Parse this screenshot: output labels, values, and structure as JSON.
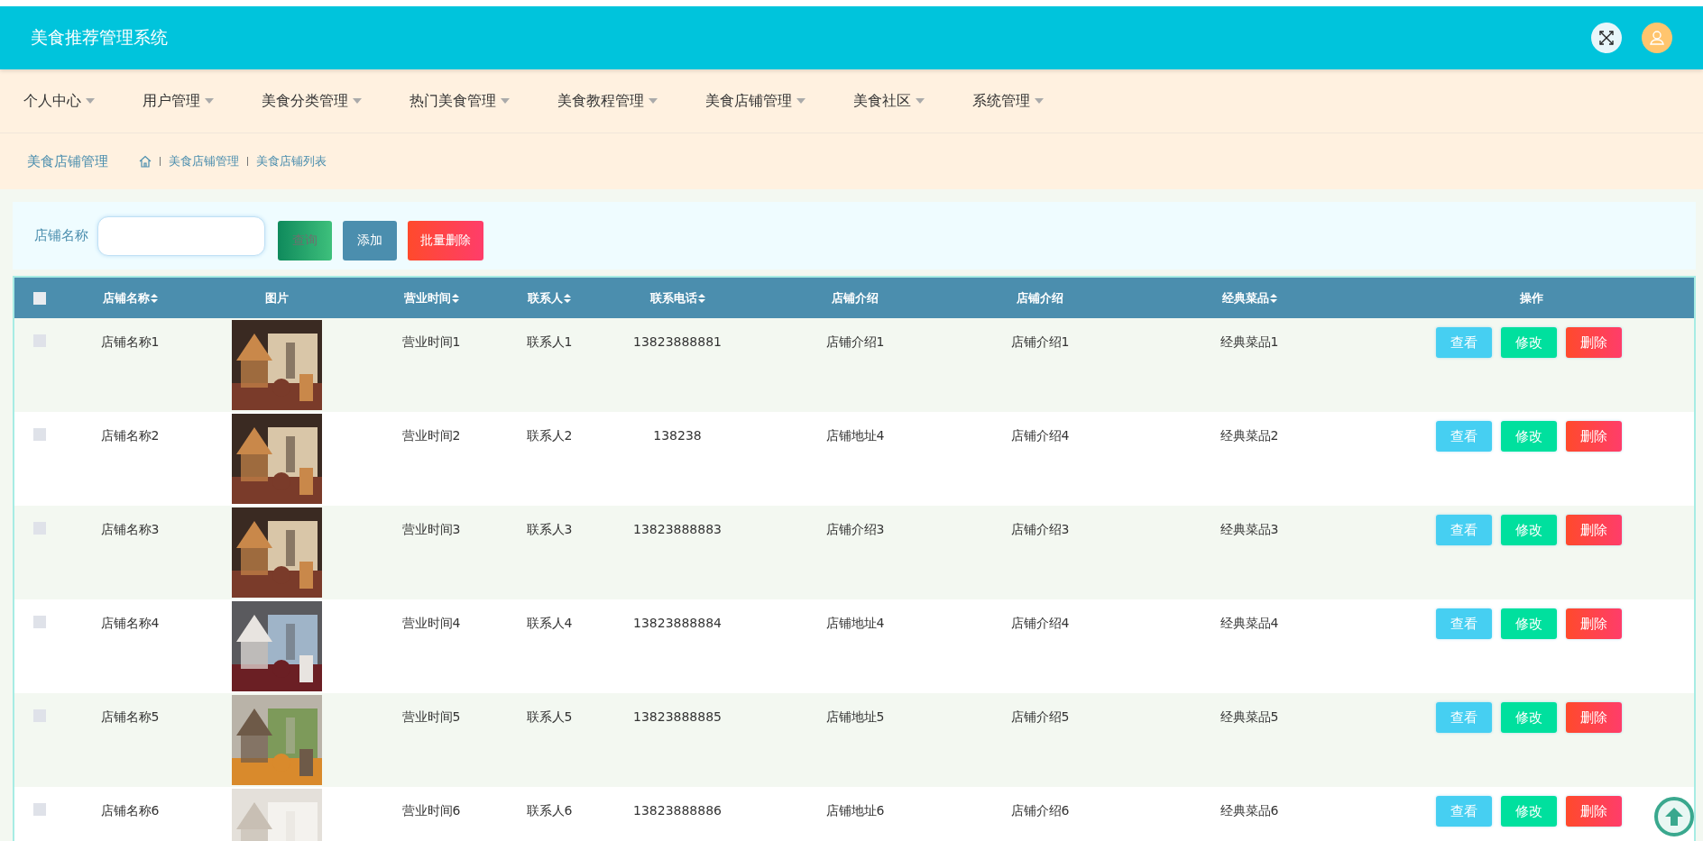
{
  "header": {
    "title": "美食推荐管理系统"
  },
  "nav": [
    {
      "label": "个人中心"
    },
    {
      "label": "用户管理"
    },
    {
      "label": "美食分类管理"
    },
    {
      "label": "热门美食管理"
    },
    {
      "label": "美食教程管理"
    },
    {
      "label": "美食店铺管理"
    },
    {
      "label": "美食社区"
    },
    {
      "label": "系统管理"
    }
  ],
  "breadcrumb": {
    "page_title": "美食店铺管理",
    "path": [
      "美食店铺管理",
      "美食店铺列表"
    ]
  },
  "search": {
    "label": "店铺名称",
    "buttons": [
      {
        "label": "查询",
        "kind": "query"
      },
      {
        "label": "添加",
        "kind": "add"
      },
      {
        "label": "批量删除",
        "kind": "delete"
      }
    ]
  },
  "table": {
    "select_all": {
      "checked": false
    },
    "columns": [
      {
        "label": "店铺名称",
        "sortable": true
      },
      {
        "label": "图片",
        "sortable": false
      },
      {
        "label": "营业时间",
        "sortable": true
      },
      {
        "label": "联系人",
        "sortable": true
      },
      {
        "label": "联系电话",
        "sortable": true
      },
      {
        "label": "店铺介绍",
        "sortable": false
      },
      {
        "label": "店铺介绍",
        "sortable": false
      },
      {
        "label": "经典菜品",
        "sortable": true
      },
      {
        "label": "操作",
        "sortable": false
      }
    ],
    "rows": [
      {
        "checked": false,
        "name": "店铺名称1",
        "hours": "营业时间1",
        "contact": "联系人1",
        "phone": "13823888881",
        "intro_1": "店铺介绍1",
        "intro_2": "店铺介绍1",
        "dish": "经典菜品1",
        "actions": [
          "查看",
          "修改",
          "删除"
        ]
      },
      {
        "checked": false,
        "name": "店铺名称2",
        "hours": "营业时间2",
        "contact": "联系人2",
        "phone": "138238",
        "intro_1": "店铺地址4",
        "intro_2": "店铺介绍4",
        "dish": "经典菜品2",
        "actions": [
          "查看",
          "修改",
          "删除"
        ]
      },
      {
        "checked": false,
        "name": "店铺名称3",
        "hours": "营业时间3",
        "contact": "联系人3",
        "phone": "13823888883",
        "intro_1": "店铺介绍3",
        "intro_2": "店铺介绍3",
        "dish": "经典菜品3",
        "actions": [
          "查看",
          "修改",
          "删除"
        ]
      },
      {
        "checked": false,
        "name": "店铺名称4",
        "hours": "营业时间4",
        "contact": "联系人4",
        "phone": "13823888884",
        "intro_1": "店铺地址4",
        "intro_2": "店铺介绍4",
        "dish": "经典菜品4",
        "actions": [
          "查看",
          "修改",
          "删除"
        ]
      },
      {
        "checked": false,
        "name": "店铺名称5",
        "hours": "营业时间5",
        "contact": "联系人5",
        "phone": "13823888885",
        "intro_1": "店铺地址5",
        "intro_2": "店铺介绍5",
        "dish": "经典菜品5",
        "actions": [
          "查看",
          "修改",
          "删除"
        ]
      },
      {
        "checked": false,
        "name": "店铺名称6",
        "hours": "营业时间6",
        "contact": "联系人6",
        "phone": "13823888886",
        "intro_1": "店铺地址6",
        "intro_2": "店铺介绍6",
        "dish": "经典菜品6",
        "actions": [
          "查看",
          "修改",
          "删除"
        ]
      }
    ]
  }
}
